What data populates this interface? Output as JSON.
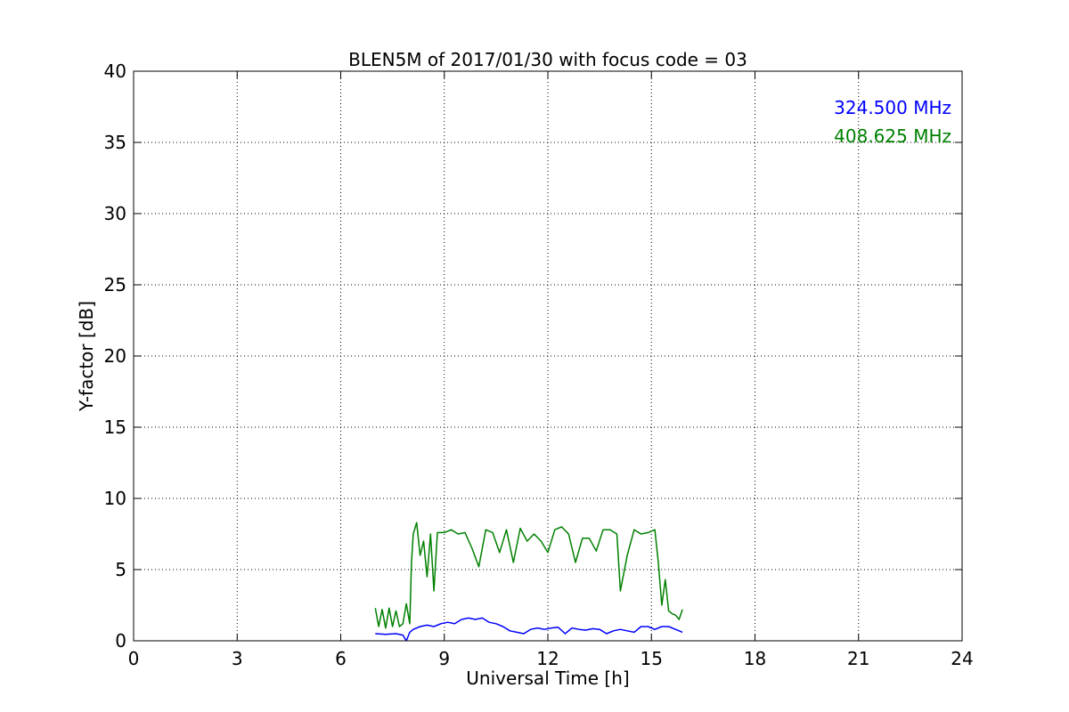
{
  "chart_data": {
    "type": "line",
    "title": "BLEN5M of 2017/01/30 with focus code = 03",
    "xlabel": "Universal Time [h]",
    "ylabel": "Y-factor [dB]",
    "xlim": [
      0,
      24
    ],
    "ylim": [
      0,
      40
    ],
    "xticks": [
      0,
      3,
      6,
      9,
      12,
      15,
      18,
      21,
      24
    ],
    "yticks": [
      0,
      5,
      10,
      15,
      20,
      25,
      30,
      35,
      40
    ],
    "grid": true,
    "legend": {
      "placement": "top-right"
    },
    "series": [
      {
        "name": "324.500 MHz",
        "color": "#0000ff",
        "x": [
          7.0,
          7.3,
          7.6,
          7.8,
          7.9,
          8.0,
          8.1,
          8.3,
          8.5,
          8.7,
          8.9,
          9.1,
          9.3,
          9.5,
          9.7,
          9.9,
          10.1,
          10.3,
          10.5,
          10.7,
          10.9,
          11.1,
          11.3,
          11.5,
          11.7,
          11.9,
          12.1,
          12.3,
          12.5,
          12.7,
          12.9,
          13.1,
          13.3,
          13.5,
          13.7,
          13.9,
          14.1,
          14.3,
          14.5,
          14.7,
          14.9,
          15.1,
          15.3,
          15.5,
          15.7,
          15.9
        ],
        "y": [
          0.5,
          0.45,
          0.5,
          0.4,
          0.0,
          0.6,
          0.8,
          1.0,
          1.1,
          1.0,
          1.2,
          1.3,
          1.2,
          1.5,
          1.6,
          1.5,
          1.6,
          1.3,
          1.2,
          1.0,
          0.7,
          0.6,
          0.5,
          0.8,
          0.9,
          0.8,
          0.9,
          0.95,
          0.5,
          0.9,
          0.8,
          0.75,
          0.85,
          0.8,
          0.5,
          0.7,
          0.8,
          0.7,
          0.6,
          1.0,
          1.0,
          0.8,
          1.0,
          1.0,
          0.8,
          0.6
        ]
      },
      {
        "name": "408.625 MHz",
        "color": "#008000",
        "x": [
          7.0,
          7.1,
          7.2,
          7.3,
          7.4,
          7.5,
          7.6,
          7.7,
          7.8,
          7.9,
          8.0,
          8.05,
          8.1,
          8.2,
          8.3,
          8.4,
          8.5,
          8.6,
          8.7,
          8.8,
          9.0,
          9.2,
          9.4,
          9.6,
          9.8,
          10.0,
          10.2,
          10.4,
          10.6,
          10.8,
          11.0,
          11.2,
          11.4,
          11.6,
          11.8,
          12.0,
          12.2,
          12.4,
          12.6,
          12.8,
          13.0,
          13.2,
          13.4,
          13.6,
          13.8,
          14.0,
          14.1,
          14.3,
          14.5,
          14.7,
          14.9,
          15.1,
          15.2,
          15.3,
          15.4,
          15.5,
          15.6,
          15.7,
          15.8,
          15.9
        ],
        "y": [
          2.3,
          1.0,
          2.2,
          0.9,
          2.3,
          1.0,
          2.1,
          1.0,
          1.2,
          2.6,
          1.2,
          5.5,
          7.5,
          8.3,
          6.0,
          7.0,
          4.5,
          7.5,
          3.5,
          7.6,
          7.6,
          7.8,
          7.5,
          7.6,
          6.5,
          5.2,
          7.8,
          7.6,
          6.2,
          7.8,
          5.5,
          7.9,
          7.0,
          7.5,
          7.0,
          6.2,
          7.8,
          8.0,
          7.5,
          5.5,
          7.2,
          7.2,
          6.3,
          7.8,
          7.8,
          7.5,
          3.5,
          6.0,
          7.8,
          7.5,
          7.6,
          7.8,
          5.5,
          2.5,
          4.3,
          2.1,
          1.9,
          1.8,
          1.5,
          2.2
        ]
      }
    ]
  }
}
